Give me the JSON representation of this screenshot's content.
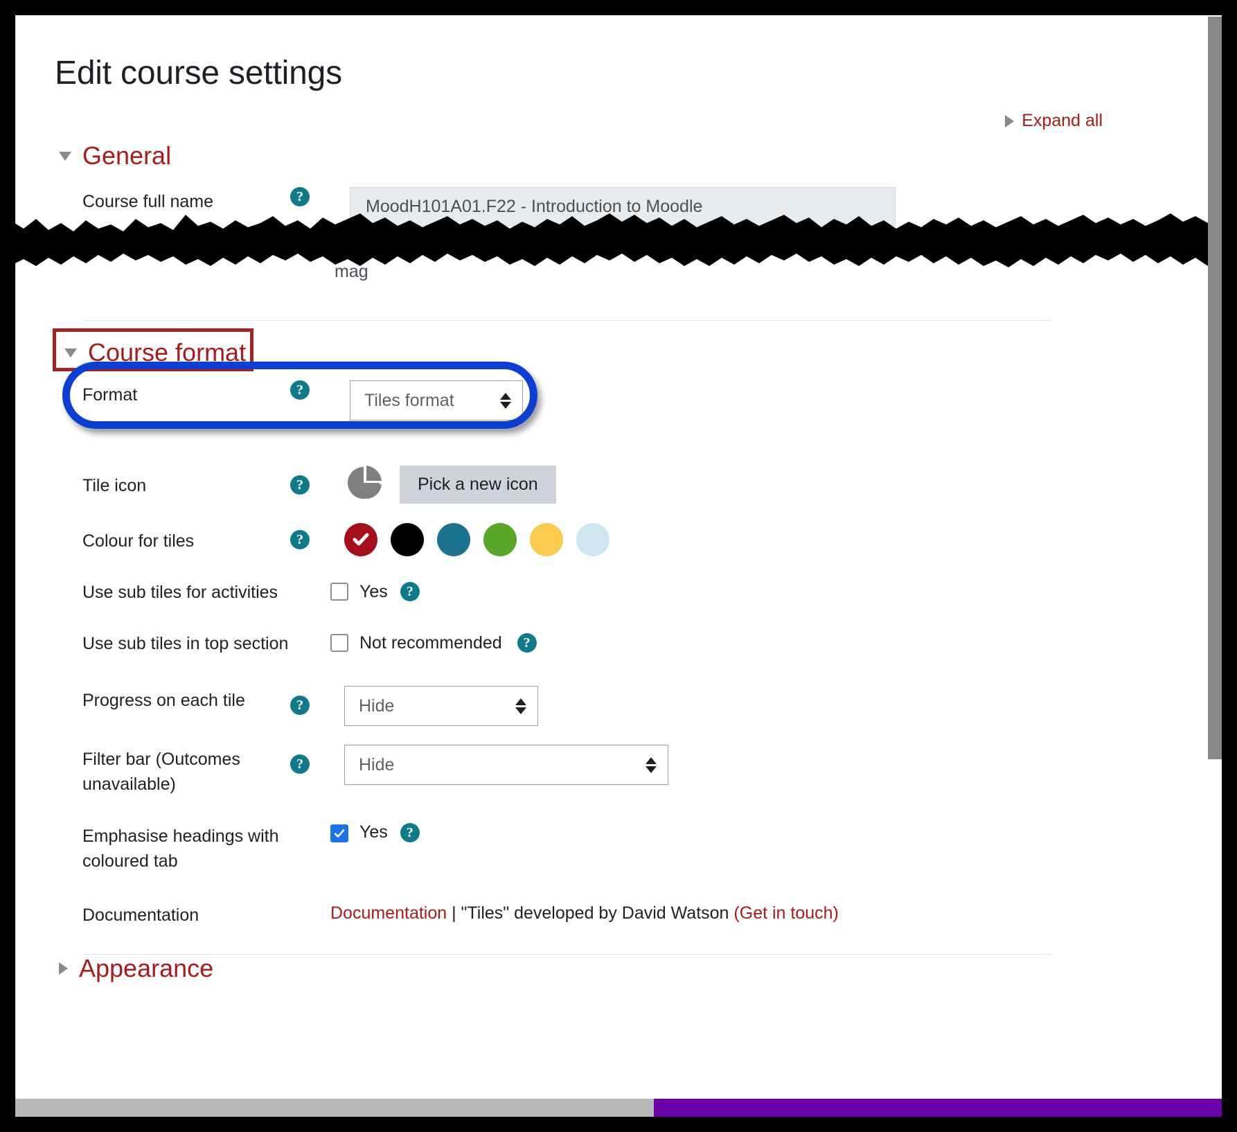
{
  "page": {
    "title": "Edit course settings",
    "expand_all": "Expand all"
  },
  "sections": {
    "general": {
      "label": "General"
    },
    "course_format": {
      "label": "Course format"
    },
    "appearance": {
      "label": "Appearance"
    }
  },
  "fields": {
    "course_full_name": {
      "label": "Course full name",
      "value": "MoodH101A01.F22 - Introduction to Moodle",
      "help": "?"
    },
    "redacted_peek": "mag",
    "format": {
      "label": "Format",
      "value": "Tiles format",
      "help": "?"
    },
    "tile_icon": {
      "label": "Tile icon",
      "button": "Pick a new icon",
      "icon": "pie-chart-icon",
      "help": "?"
    },
    "colour_for_tiles": {
      "label": "Colour for tiles",
      "help": "?",
      "selected_index": 0,
      "swatches": [
        {
          "name": "dark-red",
          "hex": "#a50f1b",
          "selected": true
        },
        {
          "name": "black",
          "hex": "#000000",
          "selected": false
        },
        {
          "name": "teal",
          "hex": "#1b7391",
          "selected": false
        },
        {
          "name": "green",
          "hex": "#5aa628",
          "selected": false
        },
        {
          "name": "yellow",
          "hex": "#fbcb4b",
          "selected": false
        },
        {
          "name": "light-blue",
          "hex": "#cde7f2",
          "selected": false
        }
      ]
    },
    "use_sub_tiles_for_activities": {
      "label": "Use sub tiles for activities",
      "checkbox_text": "Yes",
      "checked": false,
      "help": "?"
    },
    "use_sub_tiles_in_top_section": {
      "label": "Use sub tiles in top section",
      "checkbox_text": "Not recommended",
      "checked": false,
      "help": "?"
    },
    "progress_on_each_tile": {
      "label": "Progress on each tile",
      "value": "Hide",
      "help": "?"
    },
    "filter_bar": {
      "label": "Filter bar (Outcomes unavailable)",
      "value": "Hide",
      "help": "?"
    },
    "emphasise_headings": {
      "label": "Emphasise headings with coloured tab",
      "checkbox_text": "Yes",
      "checked": true,
      "help": "?"
    },
    "documentation": {
      "label": "Documentation",
      "link_text": "Documentation",
      "separator": " | ",
      "credit": "\"Tiles\" developed by David Watson ",
      "contact_link": "(Get in touch)"
    }
  },
  "annotations": {
    "red_box_target": "Course format",
    "red_box_color": "#a62121",
    "blue_oval_target": "Format",
    "blue_oval_color": "#0a3fd6",
    "redaction_color": "#000000"
  },
  "scrollbars": {
    "vertical_thumb_color": "#8a8a8a",
    "horizontal_track_color": "#b8b8b8",
    "horizontal_thumb_color": "#6a00a8"
  }
}
